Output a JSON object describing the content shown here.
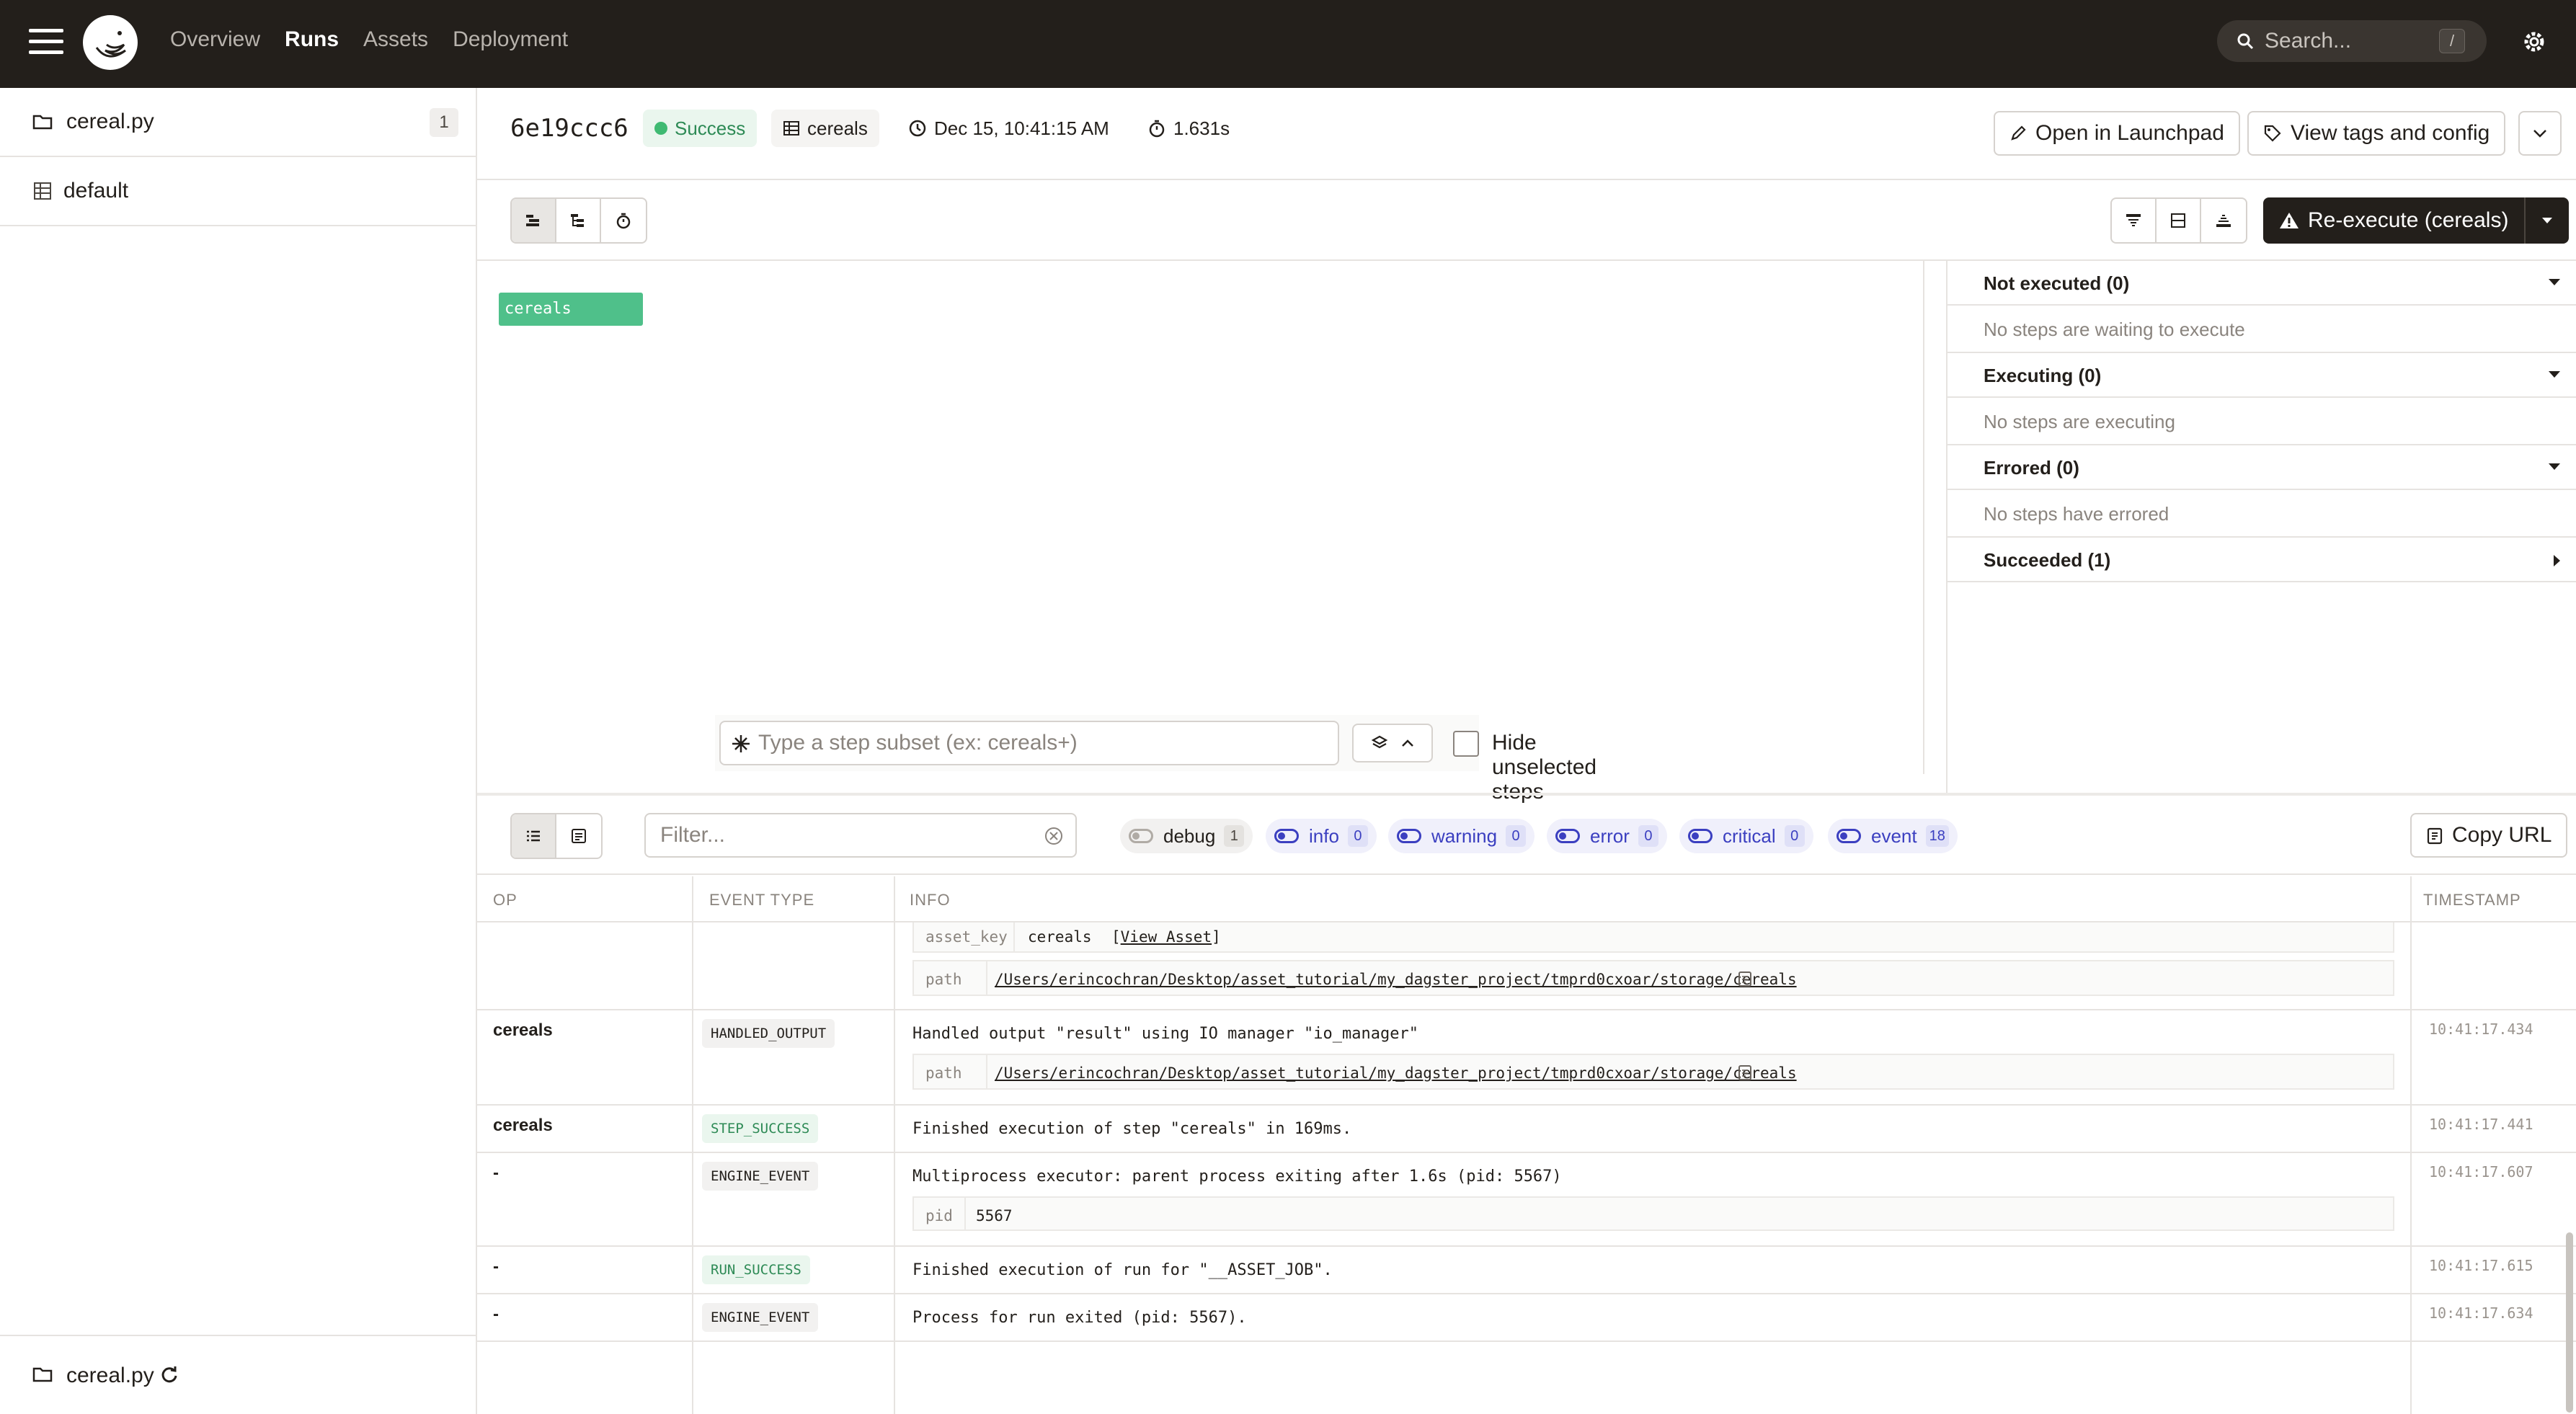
{
  "nav": {
    "links": [
      "Overview",
      "Runs",
      "Assets",
      "Deployment"
    ],
    "active": "Runs",
    "search_placeholder": "Search...",
    "search_shortcut": "/"
  },
  "sidebar": {
    "items": [
      {
        "label": "cereal.py",
        "count": "1",
        "icon": "folder-icon"
      },
      {
        "label": "default",
        "icon": "table-icon"
      }
    ],
    "footer_label": "cereal.py"
  },
  "run": {
    "id": "6e19ccc6",
    "status": "Success",
    "job": "cereals",
    "started": "Dec 15, 10:41:15 AM",
    "duration": "1.631s",
    "open_launchpad": "Open in Launchpad",
    "view_tags": "View tags and config",
    "reexecute": "Re-execute (cereals)"
  },
  "gantt": {
    "step_name": "cereals",
    "subset_placeholder": "Type a step subset (ex: cereals+)",
    "hide_unselected": "Hide unselected steps"
  },
  "step_panel": [
    {
      "title": "Not executed (0)",
      "body": "No steps are waiting to execute",
      "expanded": true
    },
    {
      "title": "Executing (0)",
      "body": "No steps are executing",
      "expanded": true
    },
    {
      "title": "Errored (0)",
      "body": "No steps have errored",
      "expanded": true
    },
    {
      "title": "Succeeded (1)",
      "body": "",
      "expanded": false
    }
  ],
  "logs": {
    "filter_placeholder": "Filter...",
    "copy_url": "Copy URL",
    "levels": [
      {
        "name": "debug",
        "count": "1",
        "enabled": false
      },
      {
        "name": "info",
        "count": "0",
        "enabled": true
      },
      {
        "name": "warning",
        "count": "0",
        "enabled": true
      },
      {
        "name": "error",
        "count": "0",
        "enabled": true
      },
      {
        "name": "critical",
        "count": "0",
        "enabled": true
      },
      {
        "name": "event",
        "count": "18",
        "enabled": true
      }
    ],
    "columns": [
      "OP",
      "EVENT TYPE",
      "INFO",
      "TIMESTAMP"
    ],
    "partial_row": {
      "asset_key_label": "asset_key",
      "asset_key_value": "cereals",
      "view_asset": "View Asset",
      "path_label": "path",
      "path_value": "/Users/erincochran/Desktop/asset_tutorial/my_dagster_project/tmprd0cxoar/storage/cereals"
    },
    "rows": [
      {
        "op": "cereals",
        "event": "HANDLED_OUTPUT",
        "msg": "Handled output \"result\" using IO manager \"io_manager\"",
        "ts": "10:41:17.434",
        "kv_label": "path",
        "kv_value": "/Users/erincochran/Desktop/asset_tutorial/my_dagster_project/tmprd0cxoar/storage/cereals"
      },
      {
        "op": "cereals",
        "event": "STEP_SUCCESS",
        "msg": "Finished execution of step \"cereals\" in 169ms.",
        "ts": "10:41:17.441"
      },
      {
        "op": "-",
        "event": "ENGINE_EVENT",
        "msg": "Multiprocess executor: parent process exiting after 1.6s (pid: 5567)",
        "ts": "10:41:17.607",
        "kv_label": "pid",
        "kv_value": "5567"
      },
      {
        "op": "-",
        "event": "RUN_SUCCESS",
        "msg": "Finished execution of run for \"__ASSET_JOB\".",
        "ts": "10:41:17.615"
      },
      {
        "op": "-",
        "event": "ENGINE_EVENT",
        "msg": "Process for run exited (pid: 5567).",
        "ts": "10:41:17.634"
      }
    ]
  }
}
